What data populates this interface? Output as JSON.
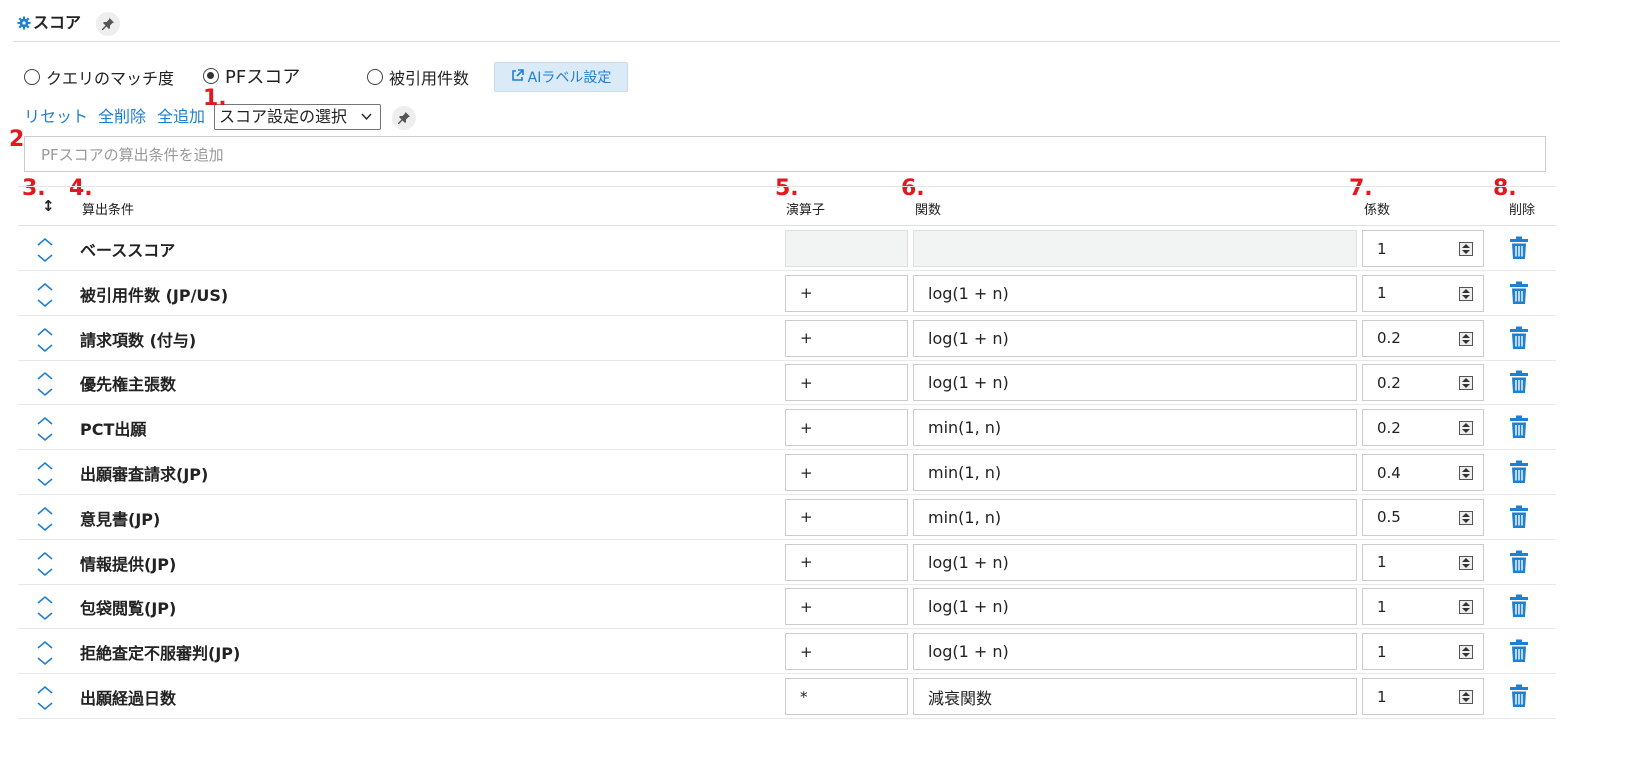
{
  "header": {
    "title": "スコア",
    "gear_icon": "gear-icon",
    "pin_icon": "pin-icon"
  },
  "score_modes": [
    {
      "label": "クエリのマッチ度",
      "selected": false
    },
    {
      "label": "PFスコア",
      "selected": true
    },
    {
      "label": "被引用件数",
      "selected": false
    }
  ],
  "ai_label_button": {
    "label": "AIラベル設定",
    "icon": "external-link-icon"
  },
  "actions": {
    "reset": "リセット",
    "delete_all": "全削除",
    "add_all": "全追加"
  },
  "score_setting_select": {
    "value": "スコア設定の選択"
  },
  "add_condition_input": {
    "placeholder": "PFスコアの算出条件を追加"
  },
  "markers": {
    "m1": "1.",
    "m2": "2.",
    "m3": "3.",
    "m4": "4.",
    "m5": "5.",
    "m6": "6.",
    "m7": "7.",
    "m8": "8."
  },
  "table": {
    "headers": {
      "sort": "↕",
      "condition": "算出条件",
      "operator": "演算子",
      "function": "関数",
      "coefficient": "係数",
      "delete": "削除"
    },
    "rows": [
      {
        "name": "ベーススコア",
        "operator": "",
        "function": "",
        "coefficient": "1",
        "disabled": true
      },
      {
        "name": "被引用件数 (JP/US)",
        "operator": "+",
        "function": "log(1 + n)",
        "coefficient": "1"
      },
      {
        "name": "請求項数 (付与)",
        "operator": "+",
        "function": "log(1 + n)",
        "coefficient": "0.2"
      },
      {
        "name": "優先権主張数",
        "operator": "+",
        "function": "log(1 + n)",
        "coefficient": "0.2"
      },
      {
        "name": "PCT出願",
        "operator": "+",
        "function": "min(1, n)",
        "coefficient": "0.2"
      },
      {
        "name": "出願審査請求(JP)",
        "operator": "+",
        "function": "min(1, n)",
        "coefficient": "0.4"
      },
      {
        "name": "意見書(JP)",
        "operator": "+",
        "function": "min(1, n)",
        "coefficient": "0.5"
      },
      {
        "name": "情報提供(JP)",
        "operator": "+",
        "function": "log(1 + n)",
        "coefficient": "1"
      },
      {
        "name": "包袋閲覧(JP)",
        "operator": "+",
        "function": "log(1 + n)",
        "coefficient": "1"
      },
      {
        "name": "拒絶査定不服審判(JP)",
        "operator": "+",
        "function": "log(1 + n)",
        "coefficient": "1"
      },
      {
        "name": "出願経過日数",
        "operator": "*",
        "function": "減衰関数",
        "coefficient": "1"
      }
    ]
  },
  "colors": {
    "accent": "#1f7fd1",
    "marker": "#e1191e",
    "button_bg": "#dbeaf7"
  }
}
